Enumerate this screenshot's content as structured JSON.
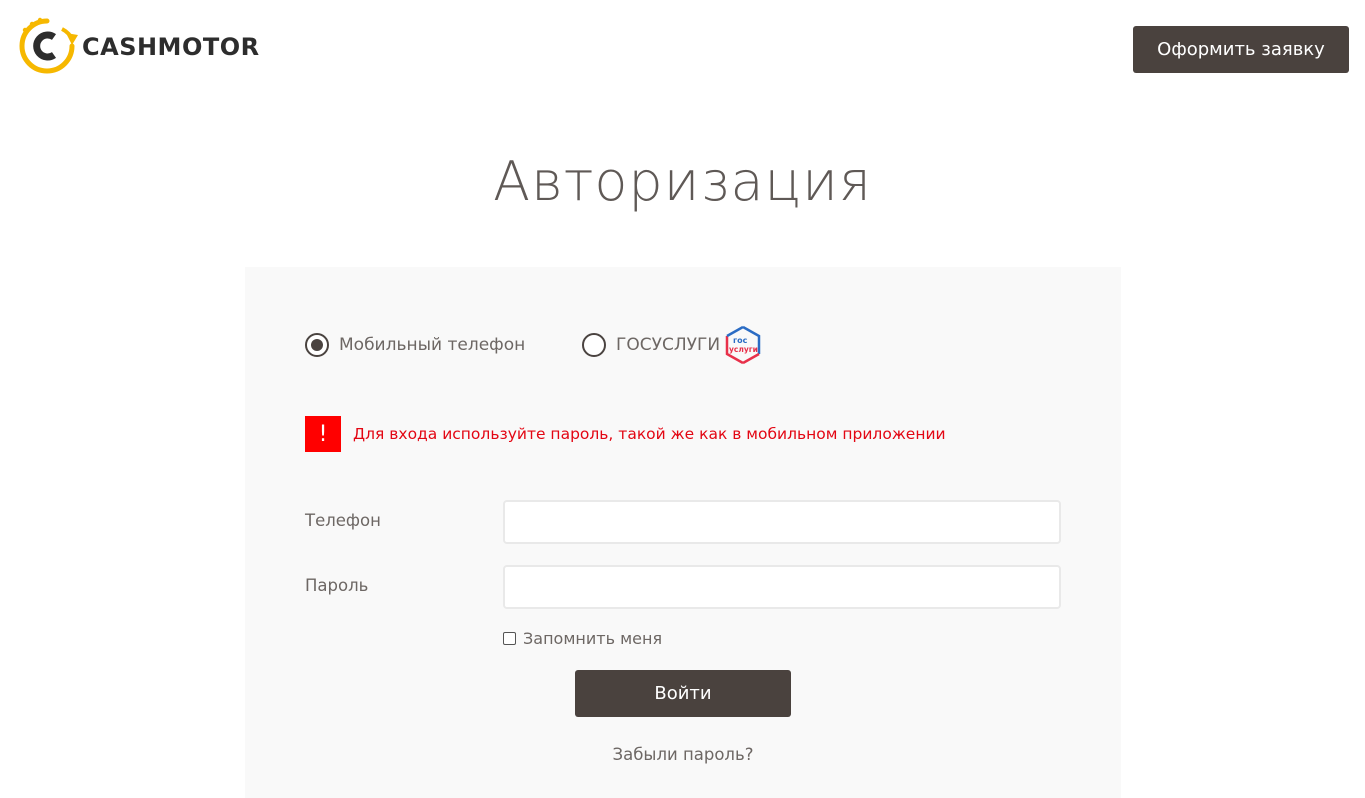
{
  "header": {
    "logo_text": "CASHMOTOR",
    "apply_button": "Оформить заявку"
  },
  "page_title": "Авторизация",
  "login_methods": {
    "phone_label": "Мобильный телефон",
    "phone_selected": true,
    "gosuslugi_label": "ГОСУСЛУГИ",
    "gosuslugi_badge_top": "гос",
    "gosuslugi_badge_bottom": "услуги"
  },
  "notice": {
    "icon": "!",
    "text": "Для входа используйте пароль, такой же как в мобильном приложении"
  },
  "form": {
    "phone_label": "Телефон",
    "phone_value": "",
    "password_label": "Пароль",
    "password_value": "",
    "remember_label": "Запомнить меня",
    "remember_checked": false,
    "submit_label": "Войти",
    "forgot_label": "Забыли пароль?"
  },
  "colors": {
    "button_bg": "#4a423e",
    "accent_yellow": "#f6b800",
    "notice_red": "#e30613",
    "panel_bg": "#f9f9f9"
  }
}
